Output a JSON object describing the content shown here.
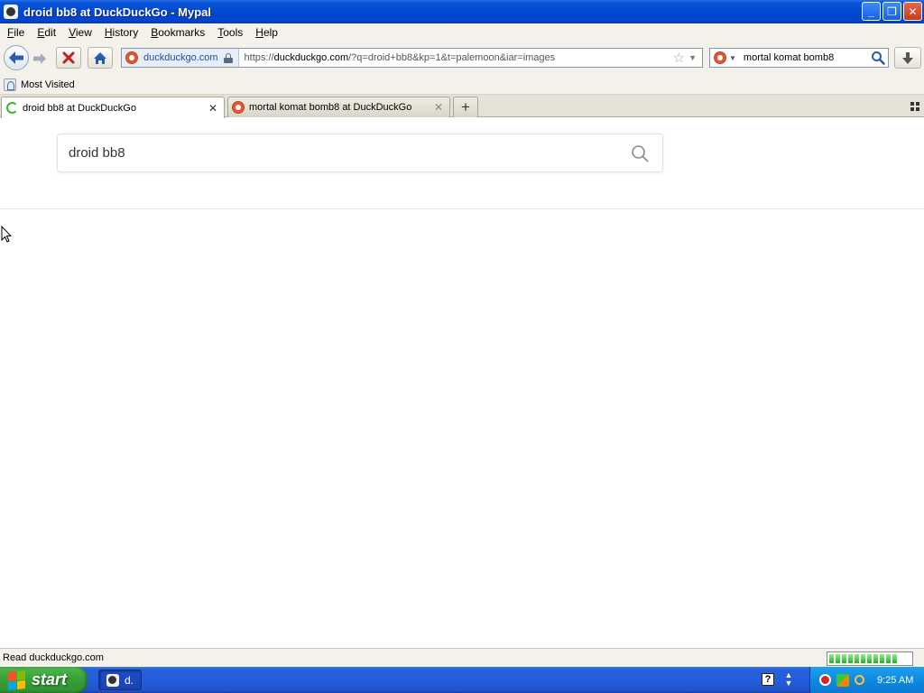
{
  "window": {
    "title": "droid bb8 at DuckDuckGo - Mypal",
    "buttons": {
      "minimize": "_",
      "maximize": "❐",
      "close": "✕"
    }
  },
  "menu": {
    "items": [
      {
        "label": "File",
        "accel": "F",
        "rest": "ile"
      },
      {
        "label": "Edit",
        "accel": "E",
        "rest": "dit"
      },
      {
        "label": "View",
        "accel": "V",
        "rest": "iew"
      },
      {
        "label": "History",
        "accel": "H",
        "rest": "istory"
      },
      {
        "label": "Bookmarks",
        "accel": "B",
        "rest": "ookmarks"
      },
      {
        "label": "Tools",
        "accel": "T",
        "rest": "ools"
      },
      {
        "label": "Help",
        "accel": "H",
        "rest": "elp"
      }
    ]
  },
  "nav": {
    "identity": "duckduckgo.com",
    "url_scheme": "https://",
    "url_host": "duckduckgo.com",
    "url_path": "/?q=droid+bb8&kp=1&t=palemoon&iar=images",
    "search_value": "mortal komat bomb8"
  },
  "bookmarks": {
    "items": [
      {
        "label": "Most Visited"
      }
    ]
  },
  "tabs": [
    {
      "title": "droid bb8 at DuckDuckGo",
      "active": true,
      "loading": true
    },
    {
      "title": "mortal komat bomb8 at DuckDuckGo",
      "active": false,
      "loading": false
    }
  ],
  "newtab_label": "+",
  "content": {
    "query": "droid bb8"
  },
  "status": {
    "text": "Read duckduckgo.com",
    "progress_segments": 11
  },
  "taskbar": {
    "start_label": "start",
    "task_label": "d.",
    "help_label": "?",
    "clock": "9:25 AM"
  },
  "colors": {
    "titlebar": "#0048d0",
    "chrome": "#f3f1ea",
    "ddg_brand": "#de5833",
    "start_green": "#3aa43a",
    "tray_blue": "#0f8ae0"
  }
}
